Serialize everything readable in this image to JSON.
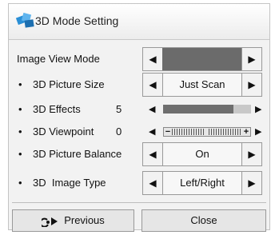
{
  "dialog": {
    "title": "3D Mode Setting",
    "icon": "3d-mode-icon"
  },
  "rows": {
    "image_view_mode": {
      "label": "Image View Mode",
      "value": ""
    },
    "picture_size": {
      "label": "3D Picture Size",
      "value": "Just Scan"
    },
    "effects": {
      "label": "3D Effects",
      "number": "5",
      "level": 0.8
    },
    "viewpoint": {
      "label": "3D Viewpoint",
      "number": "0",
      "minus": "−",
      "plus": "+"
    },
    "picture_balance": {
      "label": "3D Picture Balance",
      "value": "On"
    },
    "image_type": {
      "label": "3D  Image Type",
      "value": "Left/Right"
    }
  },
  "arrows": {
    "left": "◀",
    "right": "▶",
    "bullet": "•"
  },
  "buttons": {
    "previous": "Previous",
    "previous_icon": "back-arrow-icon",
    "close": "Close"
  },
  "colors": {
    "accent": "#2a8fd6",
    "dark_field": "#6b6b6b",
    "slider_fill": "#6e6e6e"
  }
}
